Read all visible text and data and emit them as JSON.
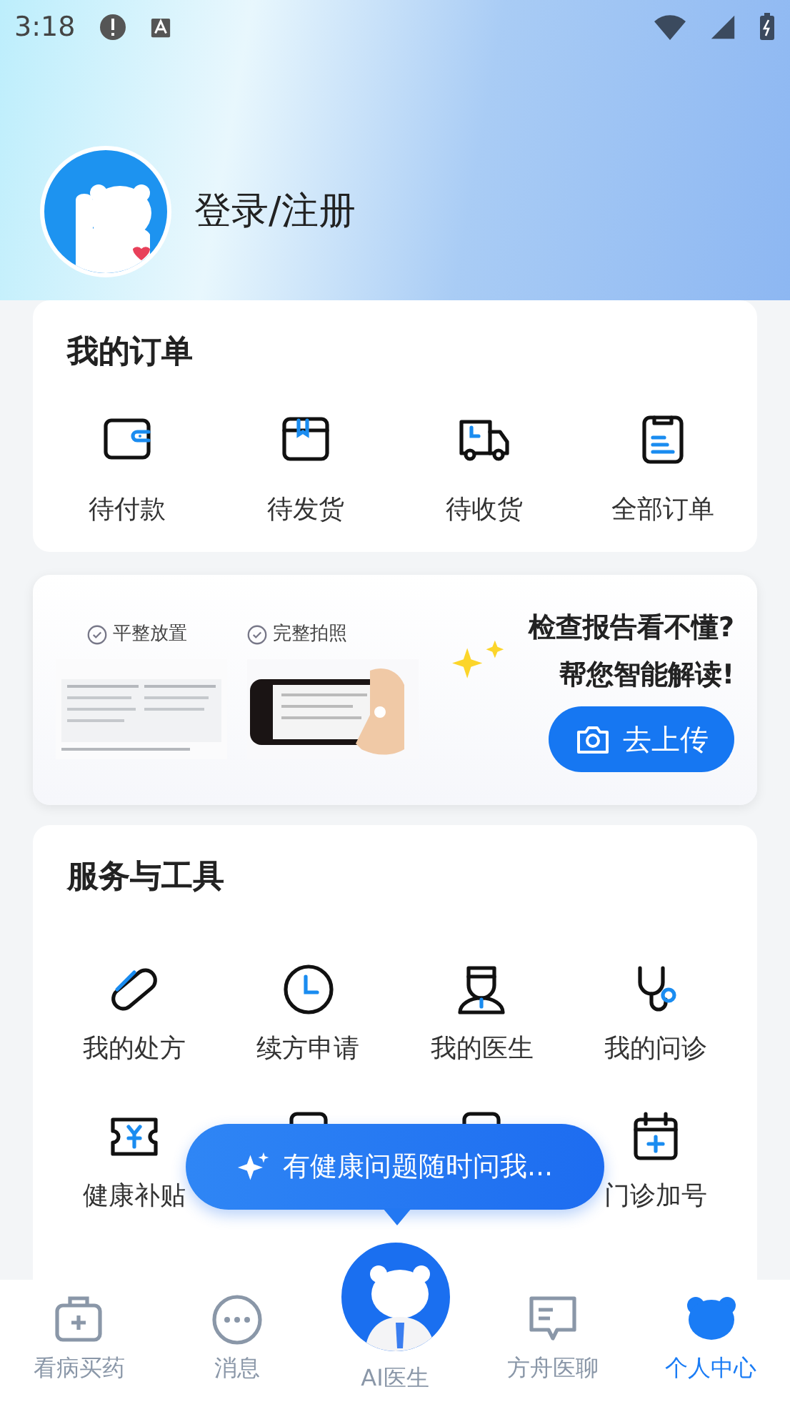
{
  "status_bar": {
    "time": "3:18"
  },
  "profile": {
    "login_text": "登录/注册"
  },
  "orders": {
    "title": "我的订单",
    "items": [
      {
        "label": "待付款"
      },
      {
        "label": "待发货"
      },
      {
        "label": "待收货"
      },
      {
        "label": "全部订单"
      }
    ]
  },
  "banner": {
    "steps": [
      "平整放置",
      "完整拍照"
    ],
    "headline": "检查报告看不懂?",
    "subline": "帮您智能解读!",
    "button": "去上传"
  },
  "services": {
    "title": "服务与工具",
    "items": [
      {
        "label": "我的处方"
      },
      {
        "label": "续方申请"
      },
      {
        "label": "我的医生"
      },
      {
        "label": "我的问诊"
      },
      {
        "label": "健康补贴"
      },
      {
        "kind": "covered"
      },
      {
        "kind": "covered"
      },
      {
        "label": "门诊加号"
      }
    ]
  },
  "ai_tip": {
    "text": "有健康问题随时问我..."
  },
  "bottom_nav": [
    {
      "label": "看病买药",
      "selected": false
    },
    {
      "label": "消息",
      "selected": false
    },
    {
      "label": "AI医生",
      "selected": false,
      "kind": "center"
    },
    {
      "label": "方舟医聊",
      "selected": false
    },
    {
      "label": "个人中心",
      "selected": true
    }
  ]
}
